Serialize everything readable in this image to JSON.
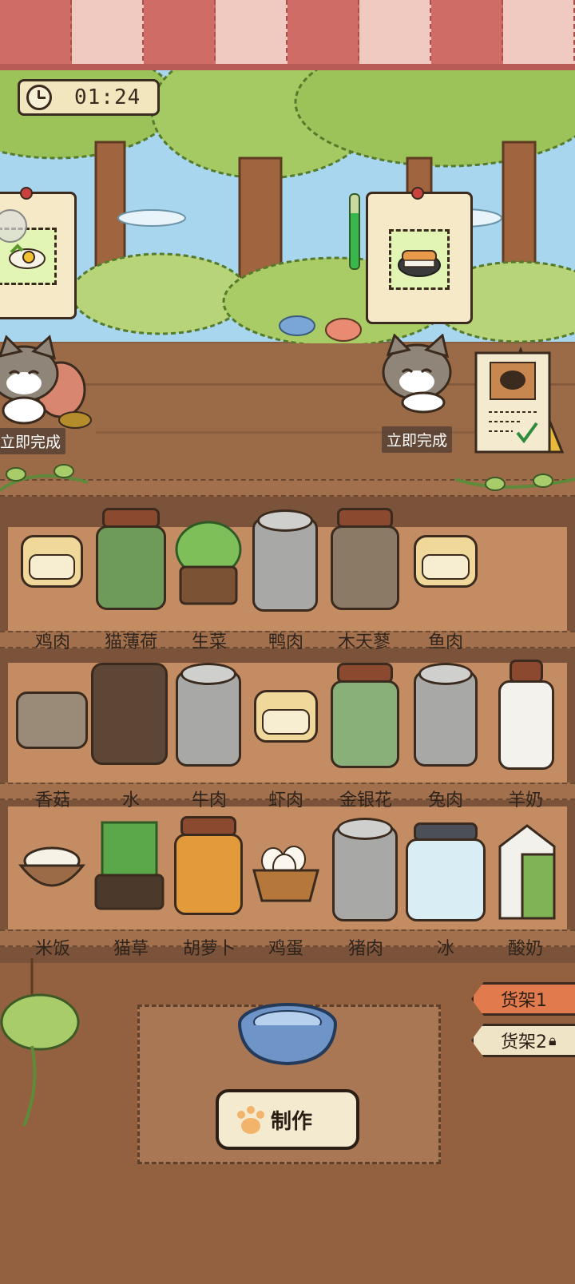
{
  "timer": {
    "time": "01:24",
    "icon": "clock-icon"
  },
  "orders": [
    {
      "food_icon": "egg-rice-icon",
      "status": "立即完成"
    },
    {
      "food_icon": "sushi-icon",
      "status": "立即完成",
      "progress_percent": 75
    }
  ],
  "shelf_rows": [
    {
      "items": [
        {
          "label": "鸡肉",
          "icon": "chicken-can-icon"
        },
        {
          "label": "猫薄荷",
          "icon": "catnip-jar-icon"
        },
        {
          "label": "生菜",
          "icon": "lettuce-basket-icon"
        },
        {
          "label": "鸭肉",
          "icon": "duck-can-icon"
        },
        {
          "label": "木天蓼",
          "icon": "silvervine-jar-icon"
        },
        {
          "label": "鱼肉",
          "icon": "fish-can-icon"
        }
      ]
    },
    {
      "items": [
        {
          "label": "香菇",
          "icon": "mushroom-jar-icon"
        },
        {
          "label": "水",
          "icon": "water-jar-icon"
        },
        {
          "label": "牛肉",
          "icon": "beef-can-icon"
        },
        {
          "label": "虾肉",
          "icon": "shrimp-can-icon"
        },
        {
          "label": "金银花",
          "icon": "honeysuckle-jar-icon"
        },
        {
          "label": "兔肉",
          "icon": "rabbit-can-icon"
        },
        {
          "label": "羊奶",
          "icon": "goat-milk-bottle-icon"
        }
      ]
    },
    {
      "items": [
        {
          "label": "米饭",
          "icon": "rice-bowl-icon"
        },
        {
          "label": "猫草",
          "icon": "cat-grass-pot-icon"
        },
        {
          "label": "胡萝卜",
          "icon": "carrot-jar-icon"
        },
        {
          "label": "鸡蛋",
          "icon": "egg-basket-icon"
        },
        {
          "label": "猪肉",
          "icon": "pork-can-icon"
        },
        {
          "label": "冰",
          "icon": "ice-jar-icon"
        },
        {
          "label": "酸奶",
          "icon": "yogurt-carton-icon"
        }
      ]
    }
  ],
  "make_button": {
    "label": "制作"
  },
  "shelf_tabs": [
    {
      "label": "货架1"
    },
    {
      "label": "货架2"
    }
  ],
  "colors": {
    "awning_red": "#d06c66",
    "awning_pink": "#f0c9c0",
    "progress_green": "#38b84a",
    "tab_active": "#e17b4e"
  }
}
